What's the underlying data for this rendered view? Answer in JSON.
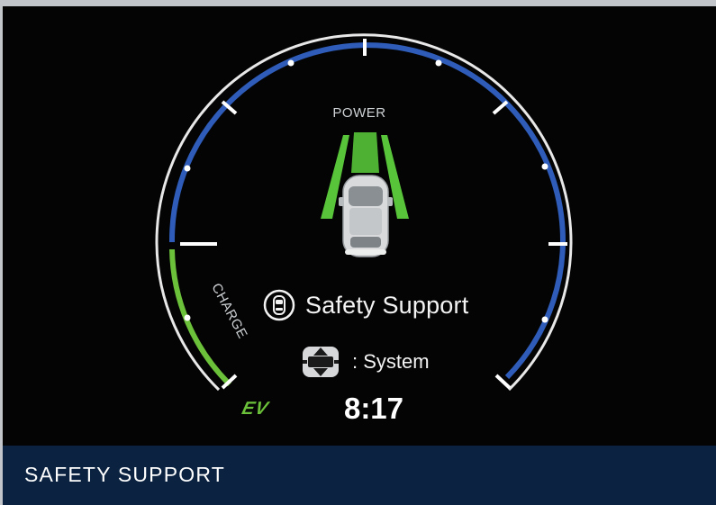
{
  "display": {
    "power_label": "POWER",
    "charge_label": "CHARGE",
    "ev_label": "EV",
    "message": "Safety Support",
    "system_text": ":  System",
    "clock": "8:17",
    "icons": {
      "message_icon": "safety-support-icon",
      "system_icon": "steering-system-icon",
      "vehicle": "car-top-view"
    }
  },
  "footer": {
    "title": "SAFETY SUPPORT"
  },
  "colors": {
    "power_arc": "#2e5cb8",
    "charge_arc": "#6cc13a",
    "footer_bg": "#0b2341",
    "screen_bg": "#040404",
    "lane_green": "#58c43a"
  }
}
